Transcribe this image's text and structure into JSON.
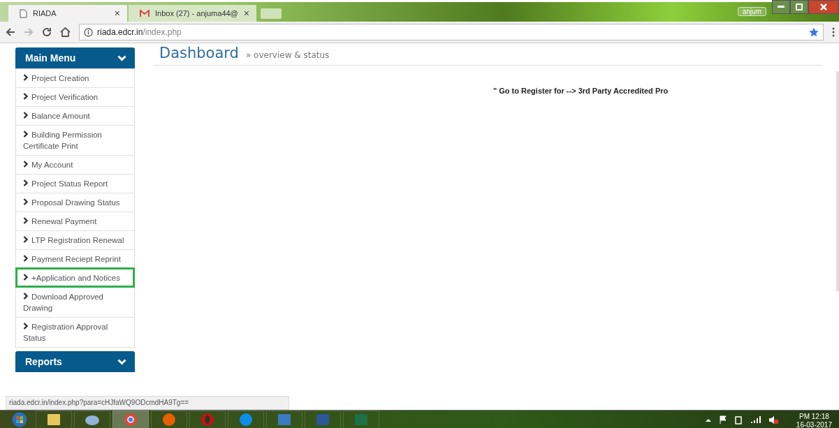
{
  "browser": {
    "tabs": [
      {
        "title": "RIADA",
        "close": "×",
        "selected": true,
        "kind": "page"
      },
      {
        "title": "Inbox (27) - anjuma44@",
        "close": "×",
        "selected": false,
        "kind": "mail"
      }
    ],
    "profile": "anjum",
    "url_host": "riada.edcr.in",
    "url_path": "/index.php"
  },
  "sidebar": {
    "header": "Main Menu",
    "items": [
      {
        "label": "Project Creation",
        "selected": false
      },
      {
        "label": "Project Verification",
        "selected": false
      },
      {
        "label": "Balance Amount",
        "selected": false
      },
      {
        "label": "Building Permission Certificate Print",
        "selected": false
      },
      {
        "label": "My Account",
        "selected": false
      },
      {
        "label": "Project Status Report",
        "selected": false
      },
      {
        "label": "Proposal Drawing Status",
        "selected": false
      },
      {
        "label": "Renewal Payment",
        "selected": false
      },
      {
        "label": "LTP Registration Renewal",
        "selected": false
      },
      {
        "label": "Payment Reciept Reprint",
        "selected": false
      },
      {
        "label": "+Application and Notices",
        "selected": true
      },
      {
        "label": "Download Approved Drawing",
        "selected": false
      },
      {
        "label": "Registration Approval Status",
        "selected": false
      }
    ],
    "reports_header": "Reports"
  },
  "page": {
    "title": "Dashboard",
    "subtitle": "» overview & status",
    "notice": "\" Go to Register for --> 3rd Party Accredited Pro"
  },
  "status_url": "riada.edcr.in/index.php?para=cHJfaWQ9ODcmdHA9Tg==",
  "taskbar": {
    "apps": [
      {
        "kind": "explorer",
        "active": false
      },
      {
        "kind": "paint",
        "active": false
      },
      {
        "kind": "chrome",
        "active": true
      },
      {
        "kind": "firefox",
        "active": false
      },
      {
        "kind": "opera",
        "active": false
      },
      {
        "kind": "teamviewer",
        "active": false
      },
      {
        "kind": "window",
        "active": false
      },
      {
        "kind": "word",
        "active": false
      },
      {
        "kind": "excel",
        "active": false
      }
    ],
    "time": "PM 12:18",
    "date": "16-03-2017"
  }
}
